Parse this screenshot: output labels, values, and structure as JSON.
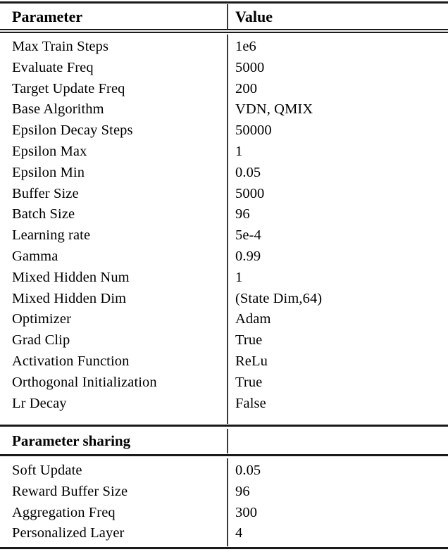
{
  "table": {
    "columns": [
      "Parameter",
      "Value"
    ],
    "sections": [
      {
        "title": null,
        "rows": [
          {
            "parameter": "Max Train Steps",
            "value": "1e6"
          },
          {
            "parameter": "Evaluate Freq",
            "value": "5000"
          },
          {
            "parameter": "Target Update Freq",
            "value": "200"
          },
          {
            "parameter": "Base Algorithm",
            "value": "VDN, QMIX"
          },
          {
            "parameter": "Epsilon Decay Steps",
            "value": "50000"
          },
          {
            "parameter": "Epsilon Max",
            "value": "1"
          },
          {
            "parameter": "Epsilon Min",
            "value": "0.05"
          },
          {
            "parameter": "Buffer Size",
            "value": "5000"
          },
          {
            "parameter": "Batch Size",
            "value": "96"
          },
          {
            "parameter": "Learning rate",
            "value": "5e-4"
          },
          {
            "parameter": "Gamma",
            "value": "0.99"
          },
          {
            "parameter": "Mixed Hidden Num",
            "value": "1"
          },
          {
            "parameter": "Mixed Hidden Dim",
            "value": "(State Dim,64)"
          },
          {
            "parameter": "Optimizer",
            "value": "Adam"
          },
          {
            "parameter": "Grad Clip",
            "value": "True"
          },
          {
            "parameter": "Activation Function",
            "value": "ReLu"
          },
          {
            "parameter": "Orthogonal Initialization",
            "value": "True"
          },
          {
            "parameter": "Lr Decay",
            "value": "False"
          }
        ]
      },
      {
        "title": "Parameter sharing",
        "rows": [
          {
            "parameter": "Soft Update",
            "value": "0.05"
          },
          {
            "parameter": "Reward Buffer Size",
            "value": "96"
          },
          {
            "parameter": "Aggregation Freq",
            "value": "300"
          },
          {
            "parameter": "Personalized Layer",
            "value": "4"
          }
        ]
      }
    ]
  },
  "style": {
    "rule_color": "#1a1a1a",
    "text_color": "#000000",
    "background": "#ffffff"
  }
}
